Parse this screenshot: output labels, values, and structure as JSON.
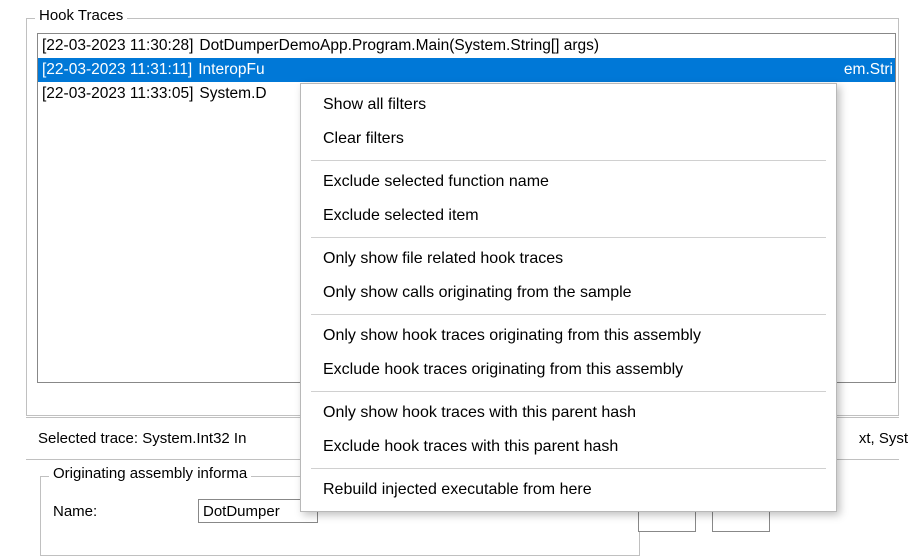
{
  "hook_traces": {
    "title": "Hook Traces",
    "rows": [
      {
        "ts": "[22-03-2023 11:30:28]",
        "fn": "DotDumperDemoApp.Program.Main(System.String[] args)",
        "selected": false
      },
      {
        "ts": "[22-03-2023 11:31:11]",
        "fn": "InteropFu",
        "selected": true,
        "tail": "em.Stri"
      },
      {
        "ts": "[22-03-2023 11:33:05]",
        "fn": "System.D",
        "selected": false
      }
    ]
  },
  "selected_trace": {
    "label": "Selected trace: System.Int32 In",
    "tail": "xt, Syst"
  },
  "orig_assembly": {
    "title": "Originating assembly informa",
    "name_label": "Name:",
    "name_value": "DotDumper"
  },
  "context_menu": {
    "groups": [
      [
        "Show all filters",
        "Clear filters"
      ],
      [
        "Exclude selected function name",
        "Exclude selected item"
      ],
      [
        "Only show file related hook traces",
        "Only show calls originating from the sample"
      ],
      [
        "Only show hook traces originating from this assembly",
        "Exclude hook traces originating from this assembly"
      ],
      [
        "Only show hook traces with this parent hash",
        "Exclude hook traces with this parent hash"
      ],
      [
        "Rebuild injected executable from here"
      ]
    ]
  }
}
